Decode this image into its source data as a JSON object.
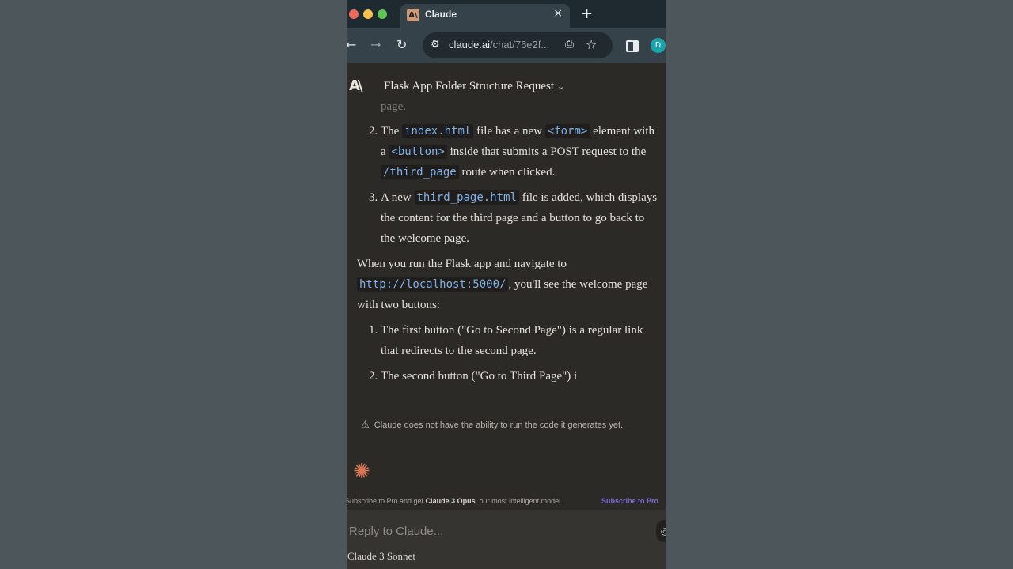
{
  "browser": {
    "tab_title": "Claude",
    "tab_favicon": "A\\",
    "close_glyph": "×",
    "newtab_glyph": "+",
    "url_host": "claude.ai",
    "url_path": "/chat/76e2f...",
    "profile_initial": "D"
  },
  "chat": {
    "title": "Flask App Folder Structure Request",
    "title_chevron": "⌄",
    "faded_top": "page."
  },
  "content": {
    "item2": {
      "t1": "The ",
      "c1": "index.html",
      "t2": " file has a new ",
      "c2": "<form>",
      "t3": " element with a ",
      "c3": "<button>",
      "t4": " inside that submits a POST request to the ",
      "c4": "/third_page",
      "t5": " route when clicked."
    },
    "item3": {
      "t1": "A new ",
      "c1": "third_page.html",
      "t2": " file is added, which displays the content for the third page and a button to go back to the welcome page."
    },
    "para": {
      "t1": "When you run the Flask app and navigate to ",
      "c1": "http://localhost:5000/",
      "t2": ", you'll see the welcome page with two buttons:"
    },
    "list2": [
      "The first button (\"Go to Second Page\") is a regular link that redirects to the second page.",
      "The second button (\"Go to Third Page\") i"
    ]
  },
  "disclaimer": "Claude does not have the ability to run the code it generates yet.",
  "promo": {
    "pre": "Subscribe to Pro and get ",
    "bold": "Claude 3 Opus",
    "post": ", our most intelligent model.",
    "link": "Subscribe to Pro"
  },
  "reply": {
    "placeholder": "Reply to Claude...",
    "model": "Claude 3 Sonnet"
  },
  "colors": {
    "accent_spark": "#d97757",
    "code_text": "#7fb0e8",
    "promo_link": "#7b6fd6"
  }
}
